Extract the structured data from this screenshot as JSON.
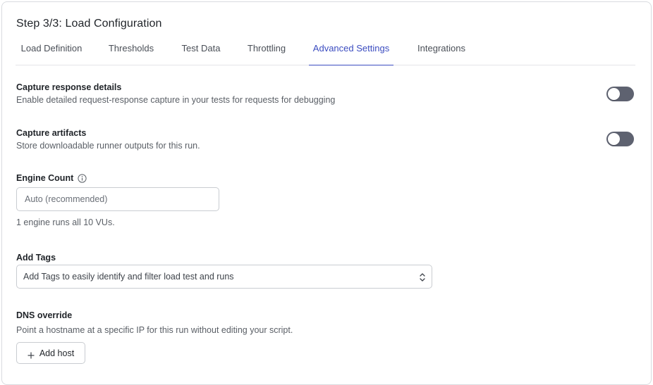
{
  "page": {
    "title": "Step 3/3: Load Configuration"
  },
  "tabs": [
    {
      "label": "Load Definition"
    },
    {
      "label": "Thresholds"
    },
    {
      "label": "Test Data"
    },
    {
      "label": "Throttling"
    },
    {
      "label": "Advanced Settings",
      "active": true
    },
    {
      "label": "Integrations"
    }
  ],
  "capture_response": {
    "title": "Capture response details",
    "description": "Enable detailed request-response capture in your tests for requests for debugging",
    "enabled": false
  },
  "capture_artifacts": {
    "title": "Capture artifacts",
    "description": "Store downloadable runner outputs for this run.",
    "enabled": false
  },
  "engine_count": {
    "label": "Engine Count",
    "info_icon": "info-icon",
    "placeholder": "Auto (recommended)",
    "value": "",
    "hint": "1 engine runs all 10 VUs."
  },
  "tags": {
    "label": "Add Tags",
    "placeholder": "Add Tags to easily identify and filter load test and runs",
    "icon": "chevron-updown-icon"
  },
  "dns_override": {
    "title": "DNS override",
    "description": "Point a hostname at a specific IP for this run without editing your script.",
    "add_host_label": "Add host",
    "icon": "plus-icon"
  },
  "colors": {
    "accent": "#3b4cc0",
    "toggle_off": "#5e6270",
    "text": "#1f2328",
    "muted": "#5a5f66"
  }
}
